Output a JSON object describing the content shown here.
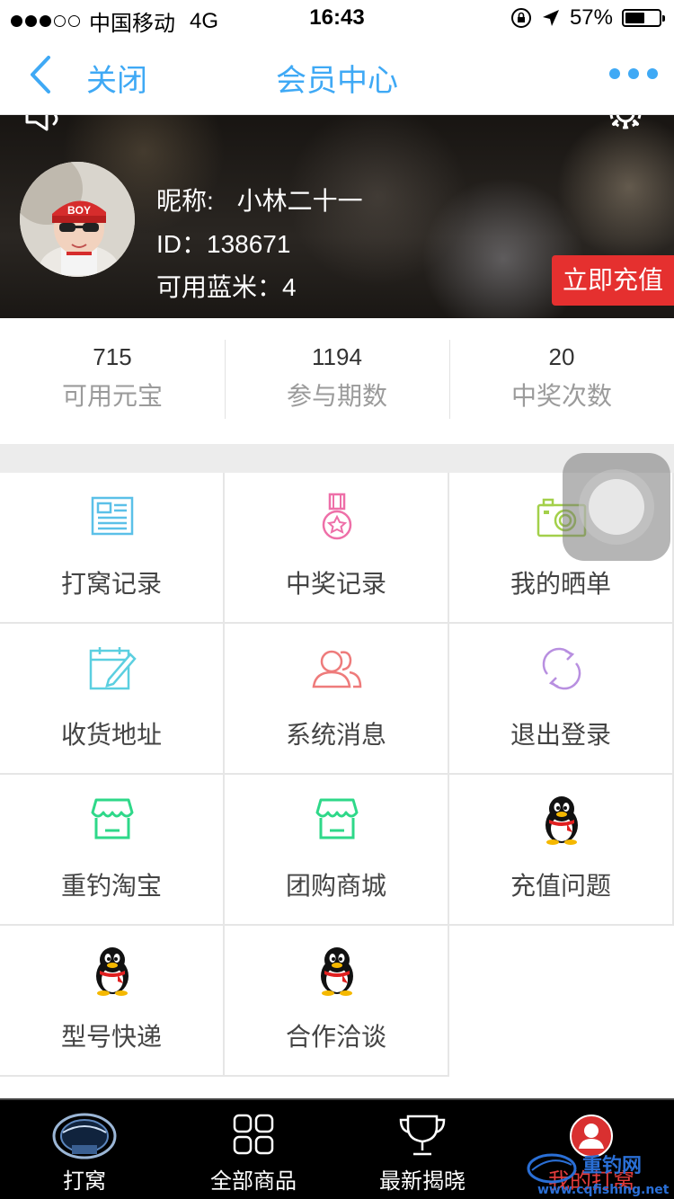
{
  "status_bar": {
    "carrier": "中国移动",
    "network": "4G",
    "time": "16:43",
    "battery": "57%",
    "battery_level": 0.57
  },
  "nav": {
    "close_label": "关闭",
    "title": "会员中心"
  },
  "profile": {
    "nickname_label": "昵称:",
    "nickname": "小林二十一",
    "id_text": "ID：138671",
    "rice_text": "可用蓝米：4",
    "recharge_label": "立即充值",
    "avatar_cap_text": "BOY"
  },
  "stats": [
    {
      "value": "715",
      "label": "可用元宝"
    },
    {
      "value": "1194",
      "label": "参与期数"
    },
    {
      "value": "20",
      "label": "中奖次数"
    }
  ],
  "menu": [
    {
      "label": "打窝记录",
      "icon": "document-icon",
      "color": "#5bc0e8"
    },
    {
      "label": "中奖记录",
      "icon": "medal-icon",
      "color": "#ee6fa8"
    },
    {
      "label": "我的晒单",
      "icon": "camera-icon",
      "color": "#a3d04a"
    },
    {
      "label": "收货地址",
      "icon": "calendar-edit-icon",
      "color": "#5bcfe0"
    },
    {
      "label": "系统消息",
      "icon": "users-icon",
      "color": "#ee7b7b"
    },
    {
      "label": "退出登录",
      "icon": "refresh-icon",
      "color": "#b88fe0"
    },
    {
      "label": "重钓淘宝",
      "icon": "store-icon",
      "color": "#2ed889"
    },
    {
      "label": "团购商城",
      "icon": "store-icon",
      "color": "#2ed889"
    },
    {
      "label": "充值问题",
      "icon": "qq-penguin-icon",
      "color": "#000000"
    },
    {
      "label": "型号快递",
      "icon": "qq-penguin-icon",
      "color": "#000000"
    },
    {
      "label": "合作洽谈",
      "icon": "qq-penguin-icon",
      "color": "#000000"
    }
  ],
  "tabbar": [
    {
      "label": "打窝",
      "icon": "brand-logo-icon"
    },
    {
      "label": "全部商品",
      "icon": "grid-icon"
    },
    {
      "label": "最新揭晓",
      "icon": "trophy-icon"
    },
    {
      "label": "我的打窝",
      "icon": "user-icon",
      "active": true
    }
  ],
  "watermark": {
    "brand": "重钓网",
    "url": "www.cqfishing.net"
  },
  "colors": {
    "accent": "#3fa9f5",
    "recharge": "#e5302f",
    "active_tab": "#e23c3c"
  }
}
